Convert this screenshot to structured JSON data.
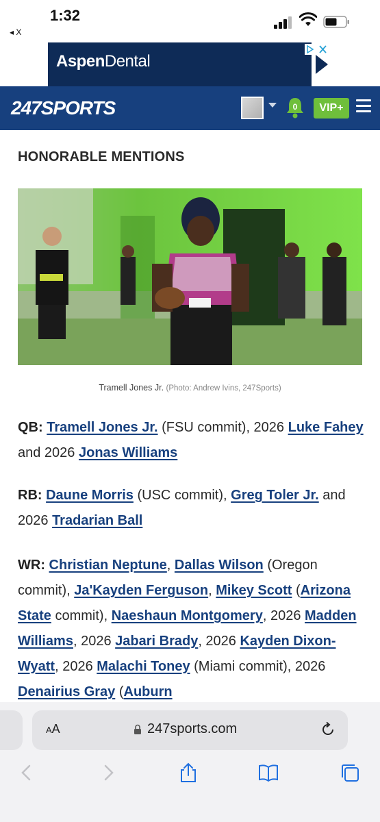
{
  "status": {
    "time": "1:32",
    "back_label": "◂ X"
  },
  "ad": {
    "brand_prefix": "Aspen",
    "brand_suffix": "Dental"
  },
  "header": {
    "logo_text": "247SPORTS",
    "notification_count": "0",
    "vip_label": "VIP+"
  },
  "article": {
    "heading": "HONORABLE MENTIONS",
    "caption": "Tramell Jones Jr.",
    "caption_credit": "(Photo: Andrew Ivins, 247Sports)",
    "qb": {
      "pos": "QB:",
      "link1": "Tramell Jones Jr.",
      "text1": " (FSU commit), 2026 ",
      "link2": "Luke Fahey",
      "text2": " and 2026 ",
      "link3": "Jonas Williams"
    },
    "rb": {
      "pos": "RB:",
      "link1": "Daune Morris",
      "text1": " (USC commit), ",
      "link2": "Greg Toler Jr.",
      "text2": " and 2026 ",
      "link3": "Tradarian Ball"
    },
    "wr": {
      "pos": "WR:",
      "link1": "Christian Neptune",
      "sep1": ", ",
      "link2": "Dallas Wilson",
      "text2": " (Oregon commit), ",
      "link3": "Ja'Kayden Ferguson",
      "sep3": ", ",
      "link4": "Mikey Scott",
      "text4a": " (",
      "link5": "Arizona State",
      "text5": " commit), ",
      "link6": "Naeshaun Montgomery",
      "text6": ", 2026 ",
      "link7": "Madden Williams",
      "text7": ", 2026 ",
      "link8": "Jabari Brady",
      "text8": ", 2026 ",
      "link9": "Kayden Dixon-Wyatt",
      "text9": ", 2026 ",
      "link10": "Malachi Toney",
      "text10": " (Miami commit), 2026 ",
      "link11": "Denairius Gray",
      "text11": " (",
      "link12": "Auburn"
    }
  },
  "browser": {
    "aa_label": "AA",
    "url": "247sports.com"
  },
  "icons": {
    "back": "chevron-left-icon",
    "forward": "chevron-right-icon",
    "share": "share-icon",
    "bookmarks": "book-icon",
    "tabs": "tabs-icon"
  }
}
